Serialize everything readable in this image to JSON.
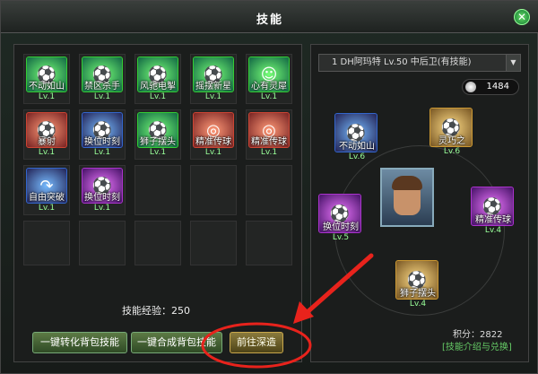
{
  "window": {
    "title": "技能",
    "close_label": "✕"
  },
  "skills": [
    {
      "name": "不动如山",
      "level": "Lv.1",
      "color": "green",
      "icon": "football-boot-icon"
    },
    {
      "name": "禁区杀手",
      "level": "Lv.1",
      "color": "green",
      "icon": "kick-icon"
    },
    {
      "name": "风驰电掣",
      "level": "Lv.1",
      "color": "green",
      "icon": "sprint-icon"
    },
    {
      "name": "摇摆新星",
      "level": "Lv.1",
      "color": "green",
      "icon": "ball-icon"
    },
    {
      "name": "心有灵犀",
      "level": "Lv.1",
      "color": "green",
      "icon": "player-face-icon"
    },
    {
      "name": "暴射",
      "level": "Lv.1",
      "color": "red",
      "icon": "shot-icon"
    },
    {
      "name": "换位时刻",
      "level": "Lv.1",
      "color": "blue",
      "icon": "swap-icon"
    },
    {
      "name": "狮子摆头",
      "level": "Lv.1",
      "color": "green",
      "icon": "header-icon"
    },
    {
      "name": "精准传球",
      "level": "Lv.1",
      "color": "red",
      "icon": "target-icon"
    },
    {
      "name": "精准传球",
      "level": "Lv.1",
      "color": "red",
      "icon": "target-icon"
    },
    {
      "name": "自由突破",
      "level": "Lv.1",
      "color": "blue",
      "icon": "arrow-icon"
    },
    {
      "name": "换位时刻",
      "level": "Lv.1",
      "color": "purple",
      "icon": "swap-icon"
    }
  ],
  "skill_exp": {
    "label": "技能经验：250"
  },
  "buttons": {
    "convert": "一键转化背包技能",
    "combine": "一键合成背包技能",
    "training": "前往深造"
  },
  "player": {
    "selected": "1 DH阿玛特 Lv.50 中后卫(有技能)",
    "coins": "1484"
  },
  "equipped": [
    {
      "name": "不动如山",
      "level": "Lv.6",
      "color": "blue",
      "icon": "football-boot-icon"
    },
    {
      "name": "灵巧之",
      "level": "Lv.6",
      "color": "gold",
      "icon": "leg-icon"
    },
    {
      "name": "换位时刻",
      "level": "Lv.5",
      "color": "purple",
      "icon": "swap-icon"
    },
    {
      "name": "精准传球",
      "level": "Lv.4",
      "color": "purple",
      "icon": "ball-icon"
    },
    {
      "name": "狮子摆头",
      "level": "Lv.4",
      "color": "gold",
      "icon": "header-icon"
    }
  ],
  "score": {
    "label": "积分：2822"
  },
  "help_link": "[技能介绍与兑换]",
  "colors": {
    "annotation": "#e8231c",
    "accent": "#6c6"
  }
}
